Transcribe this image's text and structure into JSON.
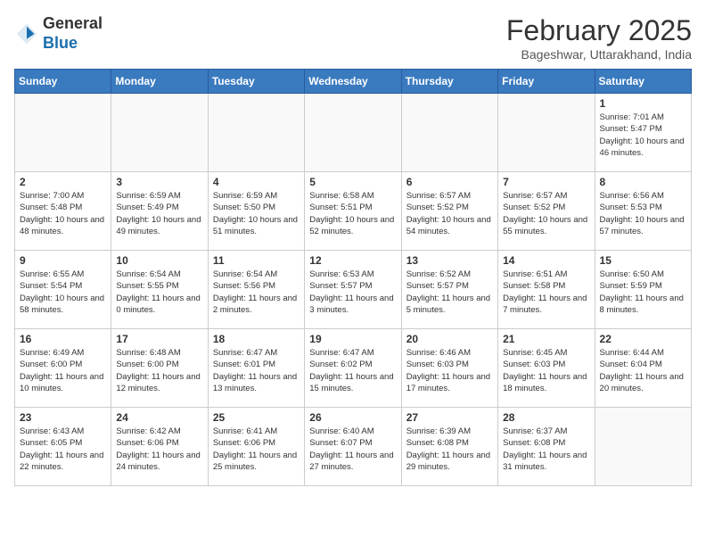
{
  "header": {
    "logo_general": "General",
    "logo_blue": "Blue",
    "month_title": "February 2025",
    "subtitle": "Bageshwar, Uttarakhand, India"
  },
  "days_of_week": [
    "Sunday",
    "Monday",
    "Tuesday",
    "Wednesday",
    "Thursday",
    "Friday",
    "Saturday"
  ],
  "weeks": [
    [
      {
        "day": "",
        "info": ""
      },
      {
        "day": "",
        "info": ""
      },
      {
        "day": "",
        "info": ""
      },
      {
        "day": "",
        "info": ""
      },
      {
        "day": "",
        "info": ""
      },
      {
        "day": "",
        "info": ""
      },
      {
        "day": "1",
        "info": "Sunrise: 7:01 AM\nSunset: 5:47 PM\nDaylight: 10 hours and 46 minutes."
      }
    ],
    [
      {
        "day": "2",
        "info": "Sunrise: 7:00 AM\nSunset: 5:48 PM\nDaylight: 10 hours and 48 minutes."
      },
      {
        "day": "3",
        "info": "Sunrise: 6:59 AM\nSunset: 5:49 PM\nDaylight: 10 hours and 49 minutes."
      },
      {
        "day": "4",
        "info": "Sunrise: 6:59 AM\nSunset: 5:50 PM\nDaylight: 10 hours and 51 minutes."
      },
      {
        "day": "5",
        "info": "Sunrise: 6:58 AM\nSunset: 5:51 PM\nDaylight: 10 hours and 52 minutes."
      },
      {
        "day": "6",
        "info": "Sunrise: 6:57 AM\nSunset: 5:52 PM\nDaylight: 10 hours and 54 minutes."
      },
      {
        "day": "7",
        "info": "Sunrise: 6:57 AM\nSunset: 5:52 PM\nDaylight: 10 hours and 55 minutes."
      },
      {
        "day": "8",
        "info": "Sunrise: 6:56 AM\nSunset: 5:53 PM\nDaylight: 10 hours and 57 minutes."
      }
    ],
    [
      {
        "day": "9",
        "info": "Sunrise: 6:55 AM\nSunset: 5:54 PM\nDaylight: 10 hours and 58 minutes."
      },
      {
        "day": "10",
        "info": "Sunrise: 6:54 AM\nSunset: 5:55 PM\nDaylight: 11 hours and 0 minutes."
      },
      {
        "day": "11",
        "info": "Sunrise: 6:54 AM\nSunset: 5:56 PM\nDaylight: 11 hours and 2 minutes."
      },
      {
        "day": "12",
        "info": "Sunrise: 6:53 AM\nSunset: 5:57 PM\nDaylight: 11 hours and 3 minutes."
      },
      {
        "day": "13",
        "info": "Sunrise: 6:52 AM\nSunset: 5:57 PM\nDaylight: 11 hours and 5 minutes."
      },
      {
        "day": "14",
        "info": "Sunrise: 6:51 AM\nSunset: 5:58 PM\nDaylight: 11 hours and 7 minutes."
      },
      {
        "day": "15",
        "info": "Sunrise: 6:50 AM\nSunset: 5:59 PM\nDaylight: 11 hours and 8 minutes."
      }
    ],
    [
      {
        "day": "16",
        "info": "Sunrise: 6:49 AM\nSunset: 6:00 PM\nDaylight: 11 hours and 10 minutes."
      },
      {
        "day": "17",
        "info": "Sunrise: 6:48 AM\nSunset: 6:00 PM\nDaylight: 11 hours and 12 minutes."
      },
      {
        "day": "18",
        "info": "Sunrise: 6:47 AM\nSunset: 6:01 PM\nDaylight: 11 hours and 13 minutes."
      },
      {
        "day": "19",
        "info": "Sunrise: 6:47 AM\nSunset: 6:02 PM\nDaylight: 11 hours and 15 minutes."
      },
      {
        "day": "20",
        "info": "Sunrise: 6:46 AM\nSunset: 6:03 PM\nDaylight: 11 hours and 17 minutes."
      },
      {
        "day": "21",
        "info": "Sunrise: 6:45 AM\nSunset: 6:03 PM\nDaylight: 11 hours and 18 minutes."
      },
      {
        "day": "22",
        "info": "Sunrise: 6:44 AM\nSunset: 6:04 PM\nDaylight: 11 hours and 20 minutes."
      }
    ],
    [
      {
        "day": "23",
        "info": "Sunrise: 6:43 AM\nSunset: 6:05 PM\nDaylight: 11 hours and 22 minutes."
      },
      {
        "day": "24",
        "info": "Sunrise: 6:42 AM\nSunset: 6:06 PM\nDaylight: 11 hours and 24 minutes."
      },
      {
        "day": "25",
        "info": "Sunrise: 6:41 AM\nSunset: 6:06 PM\nDaylight: 11 hours and 25 minutes."
      },
      {
        "day": "26",
        "info": "Sunrise: 6:40 AM\nSunset: 6:07 PM\nDaylight: 11 hours and 27 minutes."
      },
      {
        "day": "27",
        "info": "Sunrise: 6:39 AM\nSunset: 6:08 PM\nDaylight: 11 hours and 29 minutes."
      },
      {
        "day": "28",
        "info": "Sunrise: 6:37 AM\nSunset: 6:08 PM\nDaylight: 11 hours and 31 minutes."
      },
      {
        "day": "",
        "info": ""
      }
    ]
  ]
}
